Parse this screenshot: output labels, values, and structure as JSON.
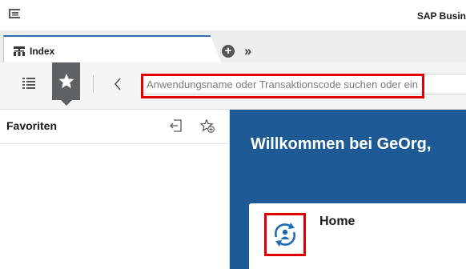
{
  "app": {
    "title": "SAP Busin"
  },
  "tabs": {
    "active_label": "Index"
  },
  "toolbar": {
    "search_placeholder": "Anwendungsname oder Transaktionscode suchen oder ein"
  },
  "sidebar": {
    "title": "Favoriten"
  },
  "main": {
    "welcome": "Willkommen bei GeOrg,",
    "tile_title": "Home"
  },
  "colors": {
    "accent": "#2f6db4",
    "main_background": "#1e5b96",
    "highlight": "#e00000",
    "fav_button": "#5e6265"
  },
  "icons": [
    "menu-toggle-icon",
    "index-tree-icon",
    "add-tab-icon",
    "more-tabs-icon",
    "list-icon",
    "star-icon",
    "back-icon",
    "import-favorites-icon",
    "add-favorite-icon",
    "home-user-refresh-icon"
  ]
}
